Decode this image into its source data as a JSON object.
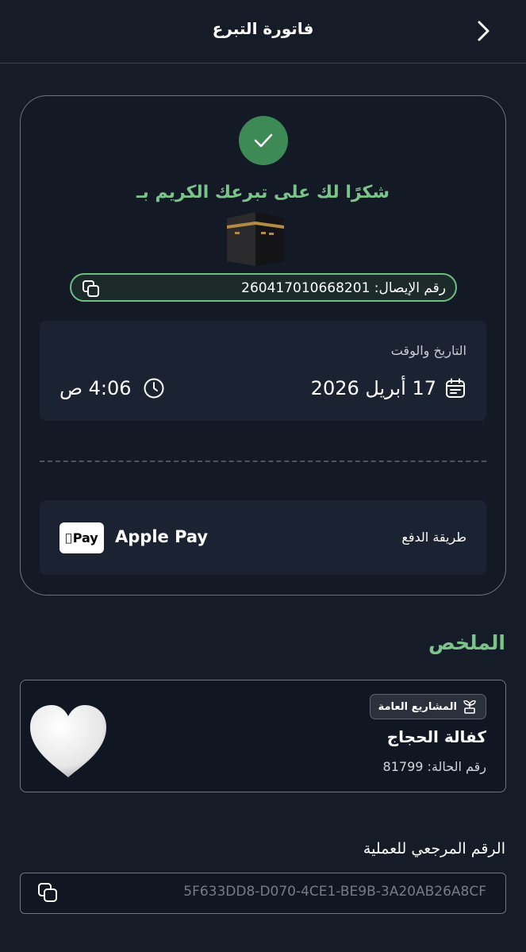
{
  "header": {
    "title": "فاتورة التبرع"
  },
  "receipt": {
    "thanks_message": "شكرًا لك على تبرعك الكريم بـ",
    "receipt_number_label": "رقم الإيصال: 260417010668201",
    "datetime_label": "التاريخ والوقت",
    "date": "17 أبريل 2026",
    "time": "4:06 ص"
  },
  "payment": {
    "label": "طريقة الدفع",
    "method": "Apple Pay",
    "badge_text": "Pay"
  },
  "summary": {
    "title": "الملخص",
    "tag": "المشاريع العامة",
    "project_name": "كفالة الحجاج",
    "case_number": "رقم الحالة: 81799"
  },
  "reference": {
    "label": "الرقم المرجعي للعملية",
    "value": "5F633DD8-D070-4CE1-BE9B-3A20AB26A8CF"
  },
  "colors": {
    "background": "#151b27",
    "accent_green": "#7cc38b",
    "check_green": "#3e8a57",
    "panel": "#1b2232"
  },
  "icons": [
    "chevron-right-icon",
    "checkmark-icon",
    "kaaba-icon",
    "copy-icon",
    "calendar-icon",
    "clock-icon",
    "apple-icon",
    "plant-icon",
    "heart-icon"
  ]
}
